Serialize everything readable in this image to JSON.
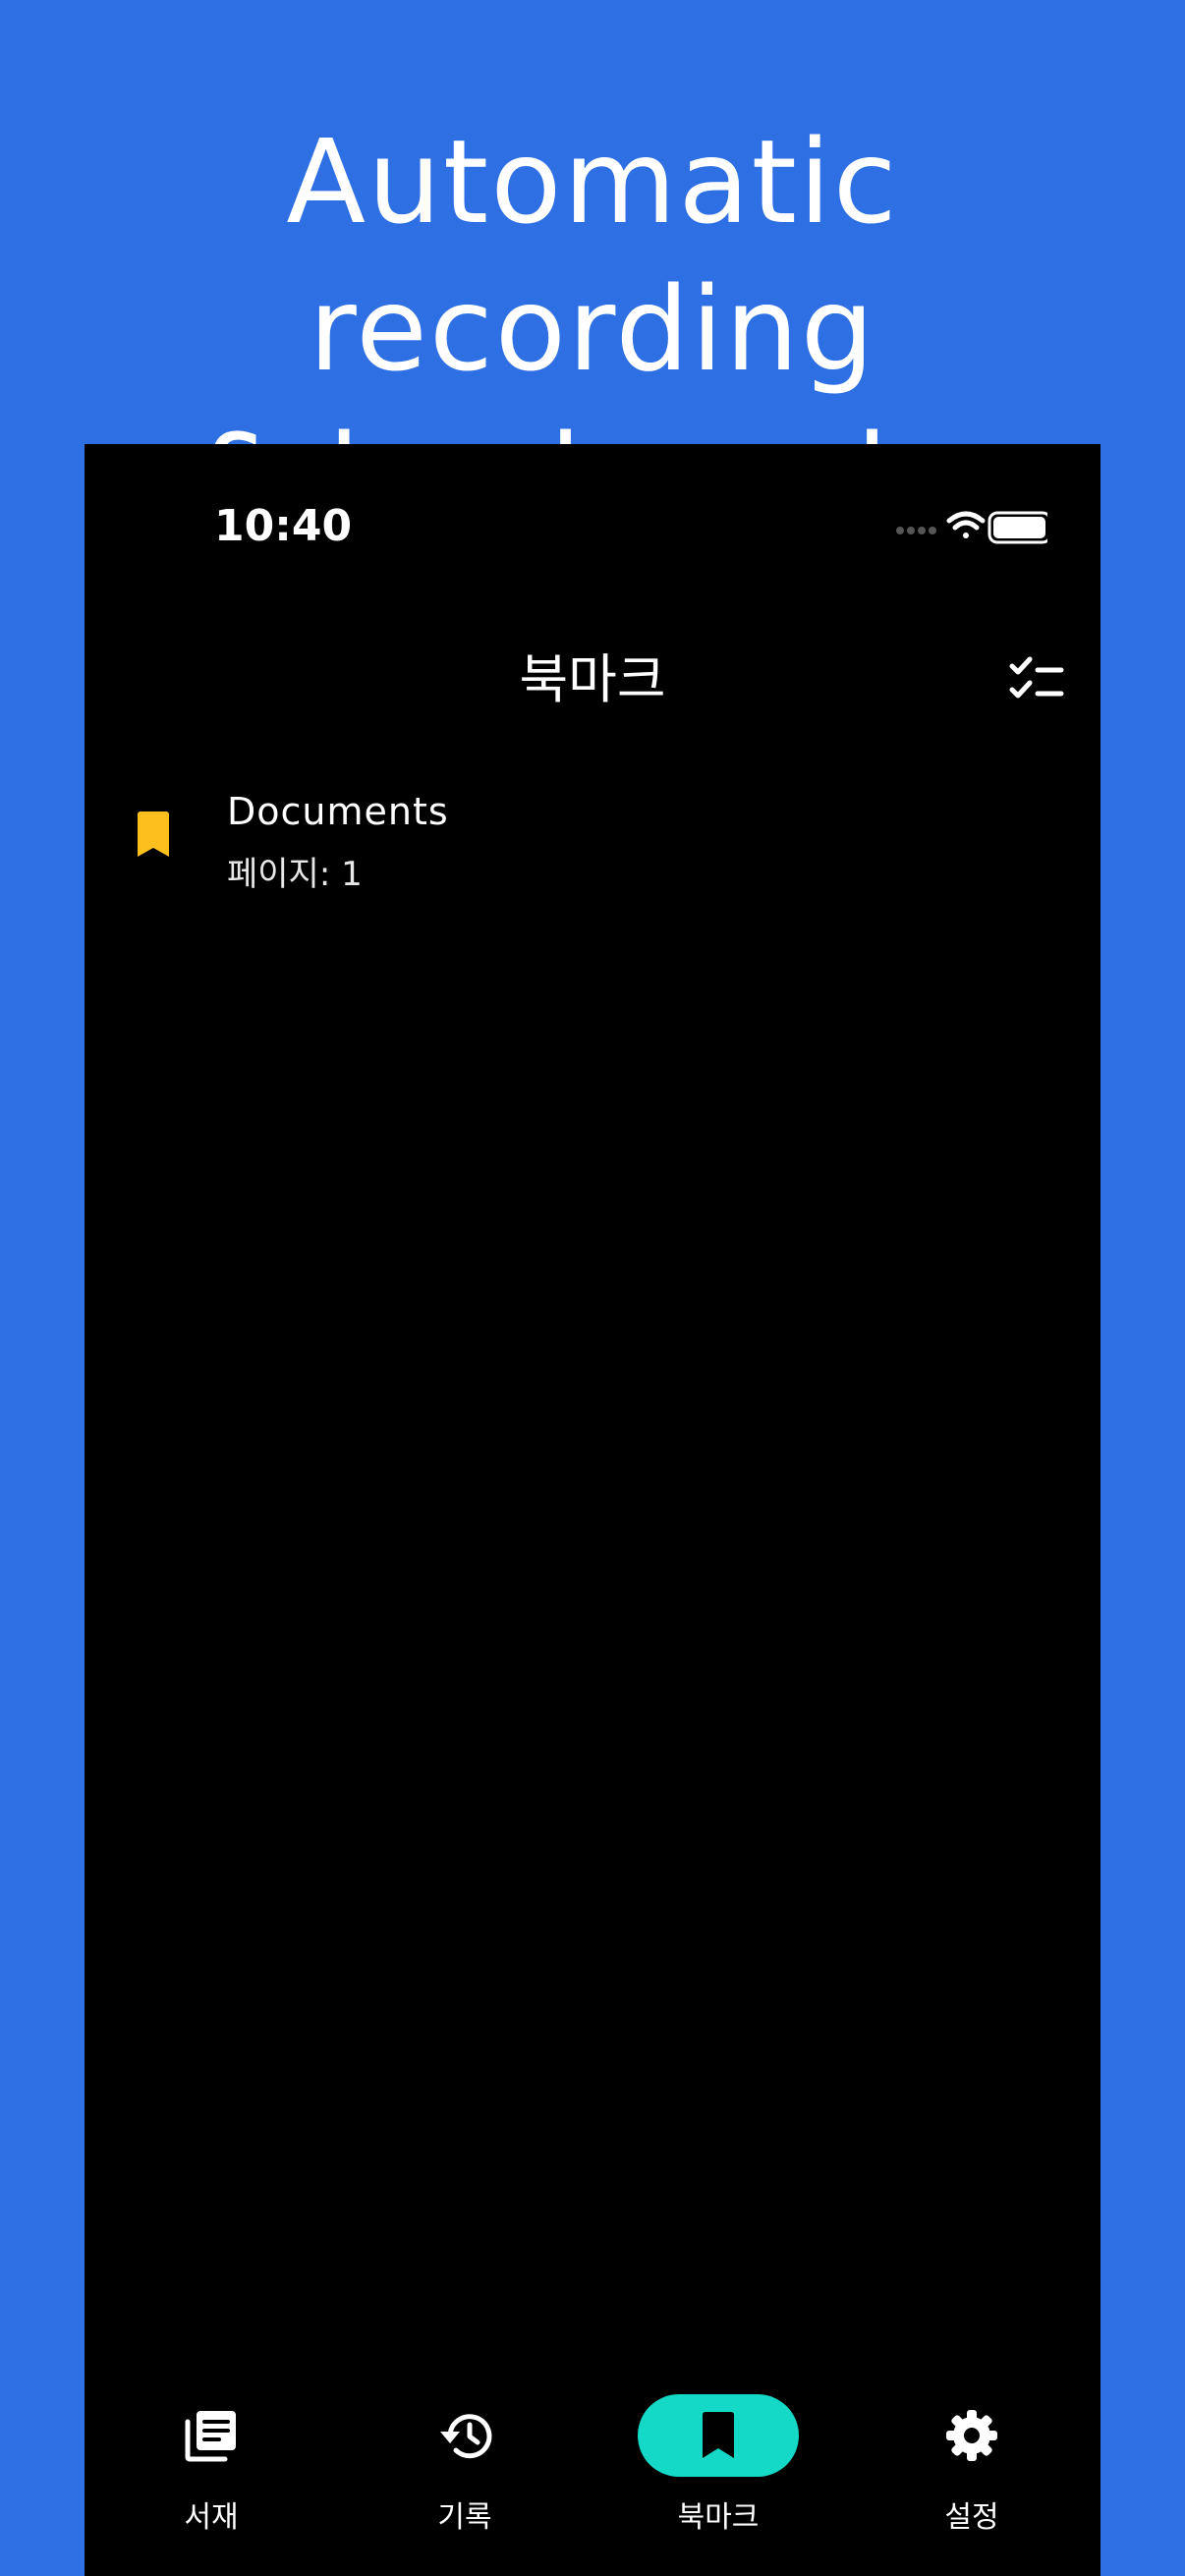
{
  "promo": {
    "line1": "Automatic recording",
    "line2": "& bookmarks"
  },
  "status_bar": {
    "time": "10:40",
    "icons": [
      "signal-dots-icon",
      "wifi-icon",
      "battery-icon"
    ]
  },
  "app_bar": {
    "title": "북마크",
    "action_icon": "checklist-icon"
  },
  "bookmarks": [
    {
      "title": "Documents",
      "subtitle": "페이지: 1",
      "icon": "bookmark-icon",
      "icon_color": "#fcbf1e"
    }
  ],
  "bottom_nav": {
    "items": [
      {
        "label": "서재",
        "icon": "library-icon",
        "active": false
      },
      {
        "label": "기록",
        "icon": "history-icon",
        "active": false
      },
      {
        "label": "북마크",
        "icon": "bookmark-icon",
        "active": true
      },
      {
        "label": "설정",
        "icon": "gear-icon",
        "active": false
      }
    ]
  },
  "colors": {
    "background": "#2e70e4",
    "screen": "#000000",
    "accent": "#14d9c6",
    "bookmark": "#fcbf1e",
    "text": "#ffffff"
  }
}
